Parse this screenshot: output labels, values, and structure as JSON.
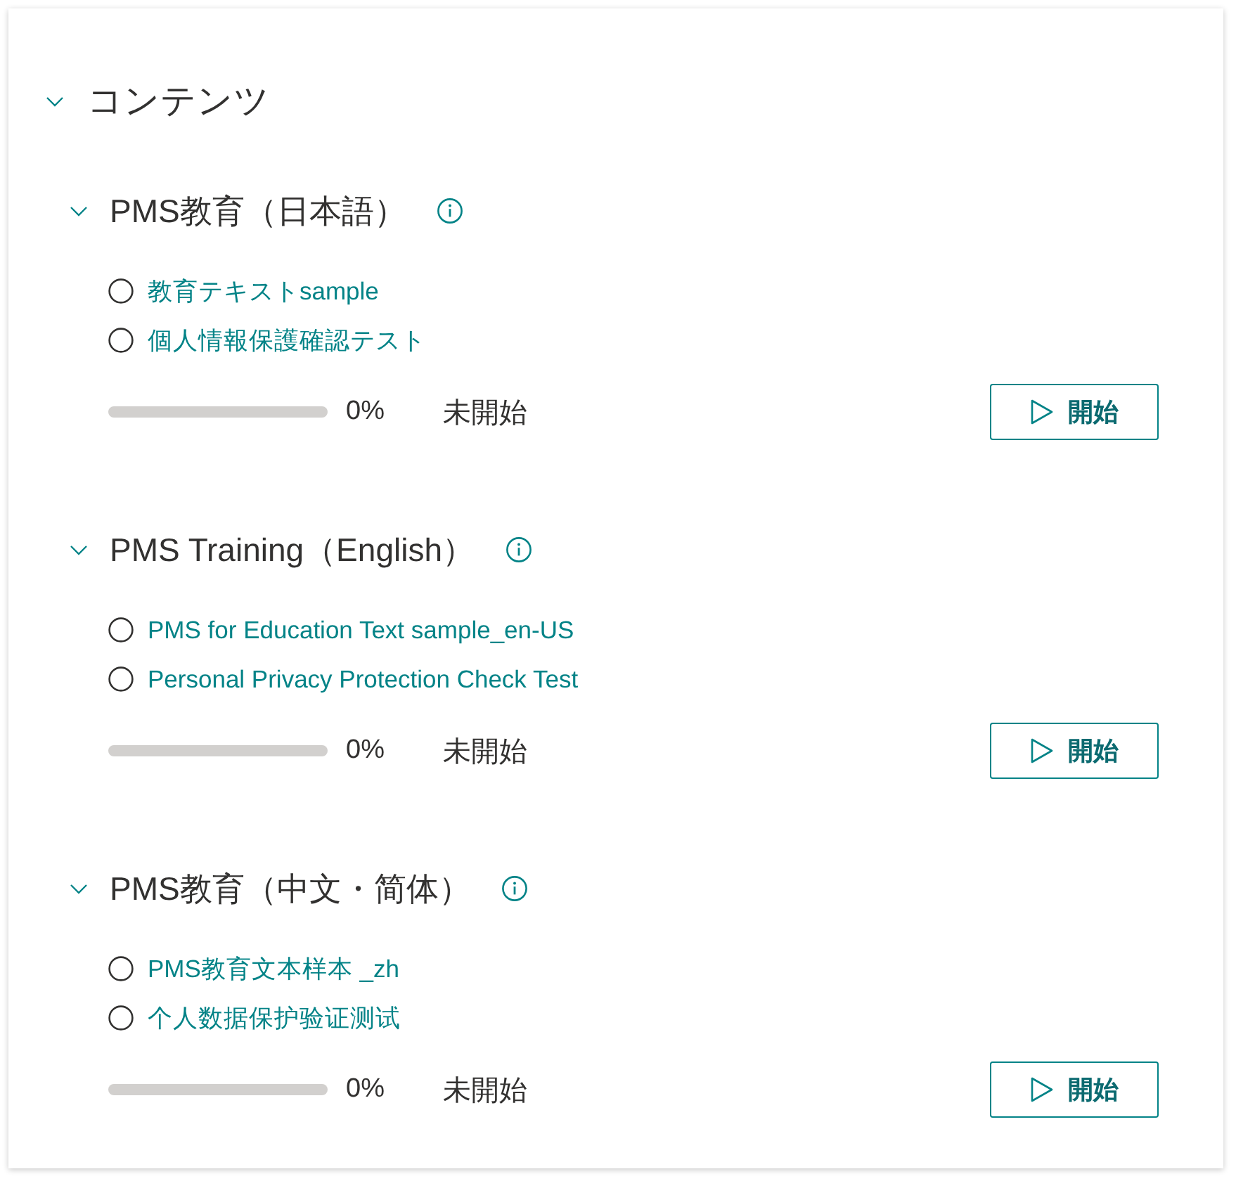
{
  "panel": {
    "title": "コンテンツ",
    "expanded": true
  },
  "groups": [
    {
      "title": "PMS教育（日本語）",
      "expanded": true,
      "items": [
        {
          "label": "教育テキストsample",
          "completed": false
        },
        {
          "label": "個人情報保護確認テスト",
          "completed": false
        }
      ],
      "progress": {
        "reading": "0%"
      },
      "status": "未開始",
      "button": {
        "label": "開始"
      }
    },
    {
      "title": "PMS Training（English）",
      "expanded": true,
      "items": [
        {
          "label": "PMS for Education Text sample_en-US",
          "completed": false
        },
        {
          "label": "Personal Privacy Protection Check Test",
          "completed": false
        }
      ],
      "progress": {
        "reading": "0%"
      },
      "status": "未開始",
      "button": {
        "label": "開始"
      }
    },
    {
      "title": "PMS教育（中文・简体）",
      "expanded": true,
      "items": [
        {
          "label": "PMS教育文本样本 _zh",
          "completed": false
        },
        {
          "label": "个人数据保护验证测试",
          "completed": false
        }
      ],
      "progress": {
        "reading": "0%"
      },
      "status": "未開始",
      "button": {
        "label": "開始"
      }
    }
  ]
}
